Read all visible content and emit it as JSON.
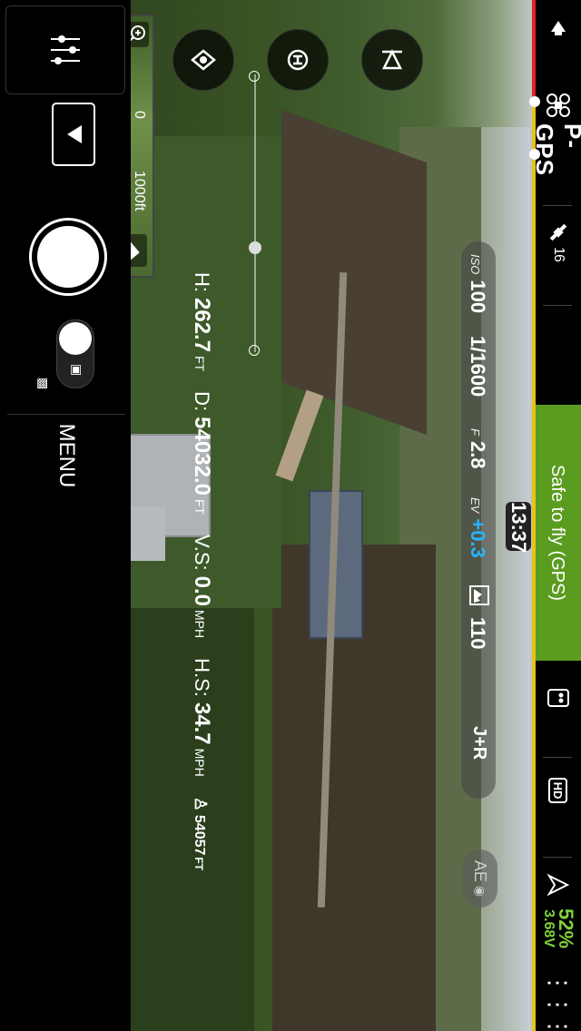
{
  "status_bar": {
    "flight_mode": "P-GPS",
    "gps_satellites": "16",
    "flight_status": "Safe to fly (GPS)",
    "battery_percent": "52%",
    "battery_voltage": "3.68V",
    "remote_signal_icon": "remote-controller-icon",
    "hd_label": "HD",
    "colors": {
      "status_ok": "#5a9c20",
      "warning_line": "#e7c21c",
      "danger_line": "#e2221f",
      "battery": "#7fd13a"
    }
  },
  "camera_settings": {
    "iso_label": "ISO",
    "iso": "100",
    "shutter": "1/1600",
    "aperture_label": "F",
    "aperture": "2.8",
    "ev_label": "EV",
    "ev": "+0.3",
    "capacity": "110",
    "format": "J+R",
    "ev_color": "#29b3ff"
  },
  "recording_time": "13:37",
  "ae_lock_label": "AE",
  "telemetry": {
    "height_label": "H:",
    "height": "262.7",
    "height_unit": "FT",
    "distance_label": "D:",
    "distance": "54032.0",
    "distance_unit": "FT",
    "vspeed_label": "V.S:",
    "vspeed": "0.0",
    "vspeed_unit": "MPH",
    "hspeed_label": "H.S:",
    "hspeed": "34.7",
    "hspeed_unit": "MPH",
    "pilot_distance": "54057",
    "pilot_distance_unit": "FT"
  },
  "map": {
    "scale_min": "0",
    "scale_max": "1000ft"
  },
  "controls": {
    "menu_label": "MENU"
  }
}
